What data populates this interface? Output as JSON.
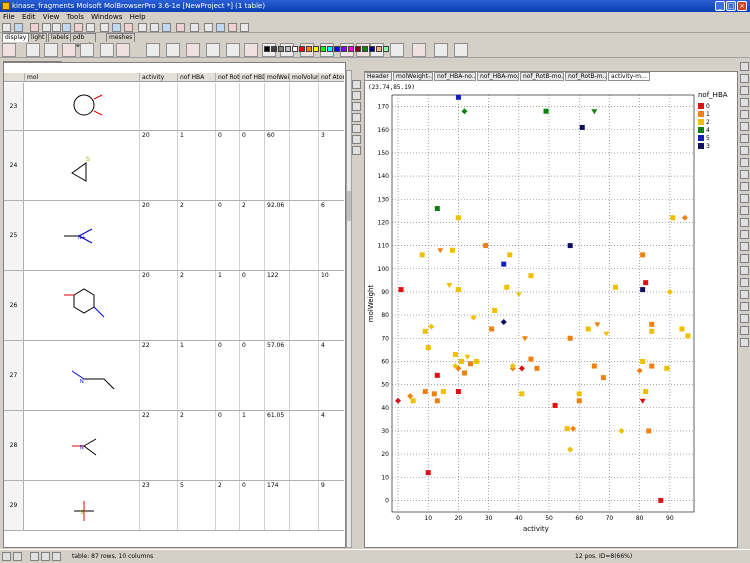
{
  "window": {
    "title": "kinase_fragments Molsoft MolBrowserPro 3.6-1e  [NewProject *] (1 table)",
    "minimize": "_",
    "maximize": "□",
    "close": "×"
  },
  "menu": [
    "File",
    "Edit",
    "View",
    "Tools",
    "Windows",
    "Help"
  ],
  "panel_tabs": [
    "display",
    "light",
    "labels",
    "pdb search",
    "meshes"
  ],
  "table_tab": "kinase_fragments",
  "table": {
    "columns": [
      "mol",
      "activity",
      "nof HBA",
      "nof RotB",
      "nof HBD",
      "molWeight",
      "molVolume",
      "nof Atom"
    ],
    "rows": [
      {
        "idx": "23",
        "activity": "",
        "hba": "",
        "rotb": "",
        "hbd": "",
        "mw": "",
        "mv": "",
        "atom": ""
      },
      {
        "idx": "24",
        "activity": "20",
        "hba": "1",
        "rotb": "0",
        "hbd": "0",
        "mw": "60",
        "mv": "",
        "atom": "3"
      },
      {
        "idx": "25",
        "activity": "20",
        "hba": "2",
        "rotb": "0",
        "hbd": "2",
        "mw": "92.06",
        "mv": "",
        "atom": "6"
      },
      {
        "idx": "26",
        "activity": "20",
        "hba": "2",
        "rotb": "1",
        "hbd": "0",
        "mw": "122",
        "mv": "",
        "atom": "10"
      },
      {
        "idx": "27",
        "activity": "22",
        "hba": "1",
        "rotb": "0",
        "hbd": "0",
        "mw": "57.06",
        "mv": "",
        "atom": "4"
      },
      {
        "idx": "28",
        "activity": "22",
        "hba": "2",
        "rotb": "0",
        "hbd": "1",
        "mw": "61.05",
        "mv": "",
        "atom": "4"
      },
      {
        "idx": "29",
        "activity": "23",
        "hba": "5",
        "rotb": "2",
        "hbd": "0",
        "mw": "174",
        "mv": "",
        "atom": "9"
      }
    ]
  },
  "right_tabs": [
    "Header",
    "molWeight-...",
    "nof_HBA-no...",
    "nof_HBA-mo...",
    "nof_RotB-mo...",
    "nof_RotB-m...",
    "activity-m..."
  ],
  "coord_readout": "(23.74,85.19)",
  "legend": {
    "title": "nof_HBA",
    "items": [
      {
        "label": "0",
        "color": "#e01010"
      },
      {
        "label": "1",
        "color": "#f08010"
      },
      {
        "label": "2",
        "color": "#f0c000"
      },
      {
        "label": "4",
        "color": "#108010"
      },
      {
        "label": "5",
        "color": "#1020c0"
      },
      {
        "label": "3",
        "color": "#101060"
      }
    ]
  },
  "status": {
    "message": "table: 87 rows, 10 columns",
    "position": "12 pos. ID=8(66%)"
  },
  "chart_data": {
    "type": "scatter",
    "xlabel": "activity",
    "ylabel": "molWeight",
    "xlim": [
      -2,
      98
    ],
    "ylim": [
      -5,
      175
    ],
    "xticks": [
      0,
      10,
      20,
      30,
      40,
      50,
      60,
      70,
      80,
      90
    ],
    "yticks": [
      0,
      10,
      20,
      30,
      40,
      50,
      60,
      70,
      80,
      90,
      100,
      110,
      120,
      130,
      140,
      150,
      160,
      170
    ],
    "grid": true,
    "legend": "right",
    "color_by": "nof_HBA",
    "points": [
      {
        "x": 0,
        "y": 43,
        "g": "0"
      },
      {
        "x": 1,
        "y": 91,
        "g": "0"
      },
      {
        "x": 10,
        "y": 12,
        "g": "0"
      },
      {
        "x": 13,
        "y": 54,
        "g": "0"
      },
      {
        "x": 20,
        "y": 47,
        "g": "0"
      },
      {
        "x": 41,
        "y": 57,
        "g": "0"
      },
      {
        "x": 52,
        "y": 41,
        "g": "0"
      },
      {
        "x": 81,
        "y": 43,
        "g": "0"
      },
      {
        "x": 82,
        "y": 94,
        "g": "0"
      },
      {
        "x": 87,
        "y": 0,
        "g": "0"
      },
      {
        "x": 4,
        "y": 45,
        "g": "1"
      },
      {
        "x": 9,
        "y": 47,
        "g": "1"
      },
      {
        "x": 12,
        "y": 46,
        "g": "1"
      },
      {
        "x": 13,
        "y": 43,
        "g": "1"
      },
      {
        "x": 14,
        "y": 108,
        "g": "1"
      },
      {
        "x": 20,
        "y": 57,
        "g": "1"
      },
      {
        "x": 22,
        "y": 55,
        "g": "1"
      },
      {
        "x": 24,
        "y": 59,
        "g": "1"
      },
      {
        "x": 29,
        "y": 110,
        "g": "1"
      },
      {
        "x": 31,
        "y": 74,
        "g": "1"
      },
      {
        "x": 38,
        "y": 57,
        "g": "1"
      },
      {
        "x": 42,
        "y": 70,
        "g": "1"
      },
      {
        "x": 44,
        "y": 61,
        "g": "1"
      },
      {
        "x": 46,
        "y": 57,
        "g": "1"
      },
      {
        "x": 57,
        "y": 70,
        "g": "1"
      },
      {
        "x": 58,
        "y": 31,
        "g": "1"
      },
      {
        "x": 60,
        "y": 43,
        "g": "1"
      },
      {
        "x": 65,
        "y": 58,
        "g": "1"
      },
      {
        "x": 66,
        "y": 76,
        "g": "1"
      },
      {
        "x": 68,
        "y": 53,
        "g": "1"
      },
      {
        "x": 80,
        "y": 56,
        "g": "1"
      },
      {
        "x": 81,
        "y": 106,
        "g": "1"
      },
      {
        "x": 84,
        "y": 76,
        "g": "1"
      },
      {
        "x": 84,
        "y": 58,
        "g": "1"
      },
      {
        "x": 83,
        "y": 30,
        "g": "1"
      },
      {
        "x": 95,
        "y": 122,
        "g": "1"
      },
      {
        "x": 5,
        "y": 43,
        "g": "2"
      },
      {
        "x": 8,
        "y": 106,
        "g": "2"
      },
      {
        "x": 9,
        "y": 73,
        "g": "2"
      },
      {
        "x": 10,
        "y": 66,
        "g": "2"
      },
      {
        "x": 11,
        "y": 75,
        "g": "2"
      },
      {
        "x": 15,
        "y": 47,
        "g": "2"
      },
      {
        "x": 17,
        "y": 93,
        "g": "2"
      },
      {
        "x": 18,
        "y": 108,
        "g": "2"
      },
      {
        "x": 19,
        "y": 63,
        "g": "2"
      },
      {
        "x": 19,
        "y": 58,
        "g": "2"
      },
      {
        "x": 20,
        "y": 91,
        "g": "2"
      },
      {
        "x": 20,
        "y": 122,
        "g": "2"
      },
      {
        "x": 21,
        "y": 60,
        "g": "2"
      },
      {
        "x": 23,
        "y": 62,
        "g": "2"
      },
      {
        "x": 25,
        "y": 79,
        "g": "2"
      },
      {
        "x": 26,
        "y": 60,
        "g": "2"
      },
      {
        "x": 32,
        "y": 82,
        "g": "2"
      },
      {
        "x": 36,
        "y": 92,
        "g": "2"
      },
      {
        "x": 37,
        "y": 106,
        "g": "2"
      },
      {
        "x": 38,
        "y": 58,
        "g": "2"
      },
      {
        "x": 40,
        "y": 89,
        "g": "2"
      },
      {
        "x": 41,
        "y": 46,
        "g": "2"
      },
      {
        "x": 44,
        "y": 97,
        "g": "2"
      },
      {
        "x": 56,
        "y": 31,
        "g": "2"
      },
      {
        "x": 57,
        "y": 22,
        "g": "2"
      },
      {
        "x": 60,
        "y": 46,
        "g": "2"
      },
      {
        "x": 63,
        "y": 74,
        "g": "2"
      },
      {
        "x": 69,
        "y": 72,
        "g": "2"
      },
      {
        "x": 72,
        "y": 92,
        "g": "2"
      },
      {
        "x": 74,
        "y": 30,
        "g": "2"
      },
      {
        "x": 81,
        "y": 60,
        "g": "2"
      },
      {
        "x": 82,
        "y": 47,
        "g": "2"
      },
      {
        "x": 84,
        "y": 73,
        "g": "2"
      },
      {
        "x": 89,
        "y": 57,
        "g": "2"
      },
      {
        "x": 90,
        "y": 90,
        "g": "2"
      },
      {
        "x": 91,
        "y": 122,
        "g": "2"
      },
      {
        "x": 94,
        "y": 74,
        "g": "2"
      },
      {
        "x": 96,
        "y": 71,
        "g": "2"
      },
      {
        "x": 13,
        "y": 126,
        "g": "4"
      },
      {
        "x": 22,
        "y": 168,
        "g": "4"
      },
      {
        "x": 49,
        "y": 168,
        "g": "4"
      },
      {
        "x": 65,
        "y": 168,
        "g": "4"
      },
      {
        "x": 20,
        "y": 174,
        "g": "5"
      },
      {
        "x": 35,
        "y": 102,
        "g": "5"
      },
      {
        "x": 35,
        "y": 77,
        "g": "3"
      },
      {
        "x": 57,
        "y": 110,
        "g": "3"
      },
      {
        "x": 61,
        "y": 161,
        "g": "3"
      },
      {
        "x": 81,
        "y": 91,
        "g": "3"
      }
    ]
  }
}
